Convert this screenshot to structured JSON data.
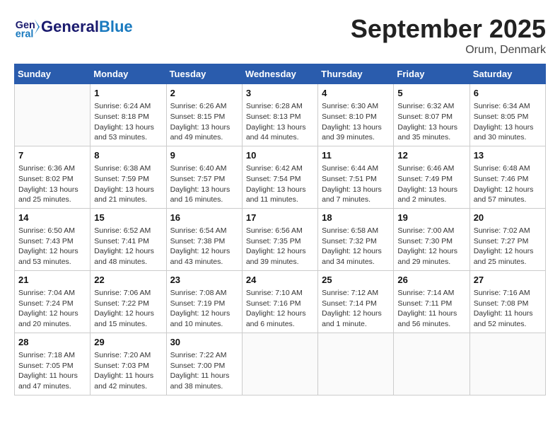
{
  "header": {
    "logo_text1": "General",
    "logo_text2": "Blue",
    "month_year": "September 2025",
    "location": "Orum, Denmark"
  },
  "days_of_week": [
    "Sunday",
    "Monday",
    "Tuesday",
    "Wednesday",
    "Thursday",
    "Friday",
    "Saturday"
  ],
  "weeks": [
    [
      {
        "day": "",
        "info": ""
      },
      {
        "day": "1",
        "info": "Sunrise: 6:24 AM\nSunset: 8:18 PM\nDaylight: 13 hours\nand 53 minutes."
      },
      {
        "day": "2",
        "info": "Sunrise: 6:26 AM\nSunset: 8:15 PM\nDaylight: 13 hours\nand 49 minutes."
      },
      {
        "day": "3",
        "info": "Sunrise: 6:28 AM\nSunset: 8:13 PM\nDaylight: 13 hours\nand 44 minutes."
      },
      {
        "day": "4",
        "info": "Sunrise: 6:30 AM\nSunset: 8:10 PM\nDaylight: 13 hours\nand 39 minutes."
      },
      {
        "day": "5",
        "info": "Sunrise: 6:32 AM\nSunset: 8:07 PM\nDaylight: 13 hours\nand 35 minutes."
      },
      {
        "day": "6",
        "info": "Sunrise: 6:34 AM\nSunset: 8:05 PM\nDaylight: 13 hours\nand 30 minutes."
      }
    ],
    [
      {
        "day": "7",
        "info": "Sunrise: 6:36 AM\nSunset: 8:02 PM\nDaylight: 13 hours\nand 25 minutes."
      },
      {
        "day": "8",
        "info": "Sunrise: 6:38 AM\nSunset: 7:59 PM\nDaylight: 13 hours\nand 21 minutes."
      },
      {
        "day": "9",
        "info": "Sunrise: 6:40 AM\nSunset: 7:57 PM\nDaylight: 13 hours\nand 16 minutes."
      },
      {
        "day": "10",
        "info": "Sunrise: 6:42 AM\nSunset: 7:54 PM\nDaylight: 13 hours\nand 11 minutes."
      },
      {
        "day": "11",
        "info": "Sunrise: 6:44 AM\nSunset: 7:51 PM\nDaylight: 13 hours\nand 7 minutes."
      },
      {
        "day": "12",
        "info": "Sunrise: 6:46 AM\nSunset: 7:49 PM\nDaylight: 13 hours\nand 2 minutes."
      },
      {
        "day": "13",
        "info": "Sunrise: 6:48 AM\nSunset: 7:46 PM\nDaylight: 12 hours\nand 57 minutes."
      }
    ],
    [
      {
        "day": "14",
        "info": "Sunrise: 6:50 AM\nSunset: 7:43 PM\nDaylight: 12 hours\nand 53 minutes."
      },
      {
        "day": "15",
        "info": "Sunrise: 6:52 AM\nSunset: 7:41 PM\nDaylight: 12 hours\nand 48 minutes."
      },
      {
        "day": "16",
        "info": "Sunrise: 6:54 AM\nSunset: 7:38 PM\nDaylight: 12 hours\nand 43 minutes."
      },
      {
        "day": "17",
        "info": "Sunrise: 6:56 AM\nSunset: 7:35 PM\nDaylight: 12 hours\nand 39 minutes."
      },
      {
        "day": "18",
        "info": "Sunrise: 6:58 AM\nSunset: 7:32 PM\nDaylight: 12 hours\nand 34 minutes."
      },
      {
        "day": "19",
        "info": "Sunrise: 7:00 AM\nSunset: 7:30 PM\nDaylight: 12 hours\nand 29 minutes."
      },
      {
        "day": "20",
        "info": "Sunrise: 7:02 AM\nSunset: 7:27 PM\nDaylight: 12 hours\nand 25 minutes."
      }
    ],
    [
      {
        "day": "21",
        "info": "Sunrise: 7:04 AM\nSunset: 7:24 PM\nDaylight: 12 hours\nand 20 minutes."
      },
      {
        "day": "22",
        "info": "Sunrise: 7:06 AM\nSunset: 7:22 PM\nDaylight: 12 hours\nand 15 minutes."
      },
      {
        "day": "23",
        "info": "Sunrise: 7:08 AM\nSunset: 7:19 PM\nDaylight: 12 hours\nand 10 minutes."
      },
      {
        "day": "24",
        "info": "Sunrise: 7:10 AM\nSunset: 7:16 PM\nDaylight: 12 hours\nand 6 minutes."
      },
      {
        "day": "25",
        "info": "Sunrise: 7:12 AM\nSunset: 7:14 PM\nDaylight: 12 hours\nand 1 minute."
      },
      {
        "day": "26",
        "info": "Sunrise: 7:14 AM\nSunset: 7:11 PM\nDaylight: 11 hours\nand 56 minutes."
      },
      {
        "day": "27",
        "info": "Sunrise: 7:16 AM\nSunset: 7:08 PM\nDaylight: 11 hours\nand 52 minutes."
      }
    ],
    [
      {
        "day": "28",
        "info": "Sunrise: 7:18 AM\nSunset: 7:05 PM\nDaylight: 11 hours\nand 47 minutes."
      },
      {
        "day": "29",
        "info": "Sunrise: 7:20 AM\nSunset: 7:03 PM\nDaylight: 11 hours\nand 42 minutes."
      },
      {
        "day": "30",
        "info": "Sunrise: 7:22 AM\nSunset: 7:00 PM\nDaylight: 11 hours\nand 38 minutes."
      },
      {
        "day": "",
        "info": ""
      },
      {
        "day": "",
        "info": ""
      },
      {
        "day": "",
        "info": ""
      },
      {
        "day": "",
        "info": ""
      }
    ]
  ]
}
